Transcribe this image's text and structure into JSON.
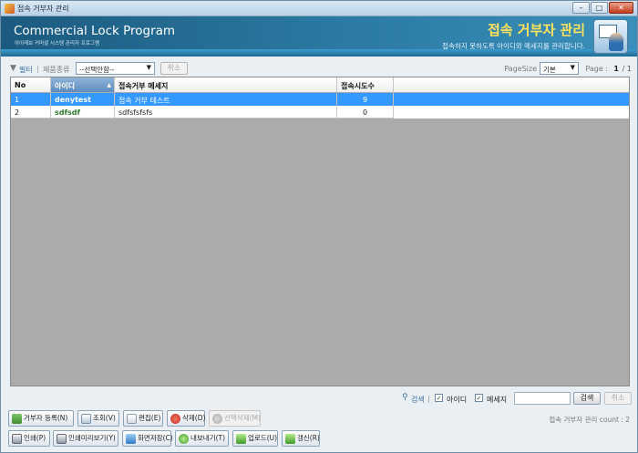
{
  "window": {
    "title": "접속 거부자 관리",
    "controls": [
      "–",
      "□",
      "✕"
    ]
  },
  "banner": {
    "program_name": "Commercial Lock Program",
    "program_sub": "아이레보 커머셜 시스템 관리자 프로그램",
    "page_title": "접속 거부자 관리",
    "page_desc": "접속하지 못하도록 아이디와 메세지를 관리합니다."
  },
  "filter": {
    "icon": "filter-icon",
    "label": "필터",
    "kind_label": "제품종류",
    "kind_selected": "--선택안함--",
    "cancel": "취소",
    "pagesize_label": "PageSize",
    "pagesize_selected": "기본",
    "page_label": "Page :",
    "page_current": "1",
    "page_total": "/ 1"
  },
  "grid": {
    "columns": [
      "No",
      "아이디",
      "접속거부 메세지",
      "접속시도수"
    ],
    "rows": [
      {
        "no": "1",
        "id": "denytest",
        "message": "접속 거부 테스트",
        "attempts": "9"
      },
      {
        "no": "2",
        "id": "sdfsdf",
        "message": "sdfsfsfsfs",
        "attempts": "0"
      }
    ]
  },
  "search": {
    "icon": "binoculars-icon",
    "label": "검색",
    "sep": "|",
    "check_id_label": "아이디",
    "check_msg_label": "메세지",
    "check_mark": "✓",
    "button": "검색",
    "cancel": "취소"
  },
  "toolbar1": {
    "add": "거부자 등록(N)",
    "view": "조회(V)",
    "edit": "편집(E)",
    "delete": "삭제(D)",
    "delete_selected": "선택삭제(M)",
    "count_text": "접속 거부자 관리 count : 2"
  },
  "toolbar2": {
    "print": "인쇄(P)",
    "preview": "인쇄미리보기(Y)",
    "screenshot": "화면저장(C)",
    "export": "내보내기(T)",
    "upload": "업로드(U)",
    "refresh": "갱신(R)"
  }
}
